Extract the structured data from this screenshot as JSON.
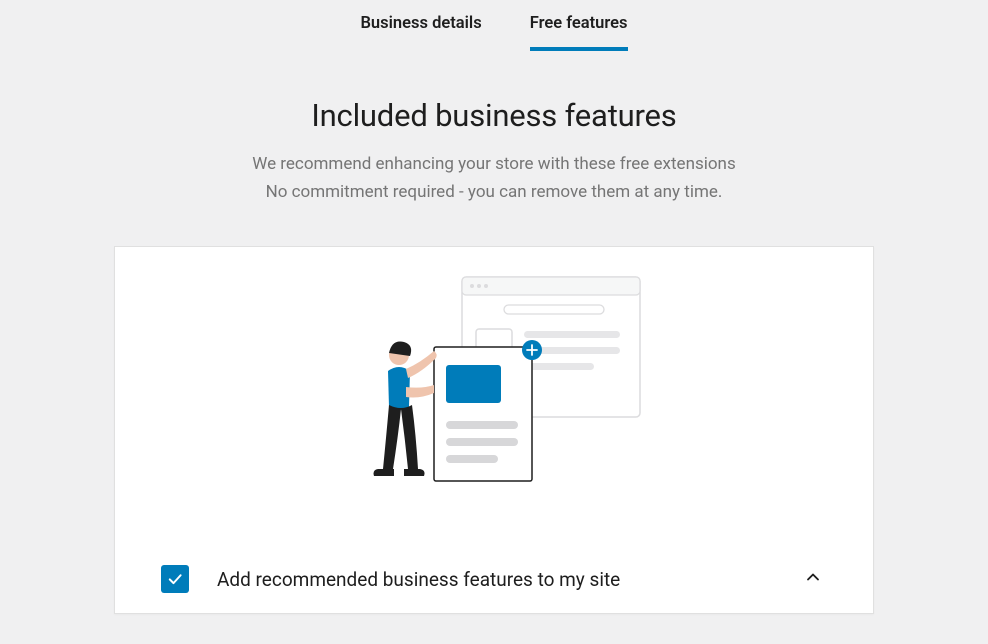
{
  "tabs": {
    "business_details": "Business details",
    "free_features": "Free features"
  },
  "heading": {
    "title": "Included business features",
    "subtitle_line1": "We recommend enhancing your store with these free extensions",
    "subtitle_line2": "No commitment required - you can remove them at any time."
  },
  "option": {
    "label": "Add recommended business features to my site",
    "checked": true
  },
  "colors": {
    "accent": "#007cba",
    "text_primary": "#1e1e1e",
    "text_muted": "#757575",
    "page_bg": "#f0f0f1",
    "card_bg": "#ffffff"
  }
}
